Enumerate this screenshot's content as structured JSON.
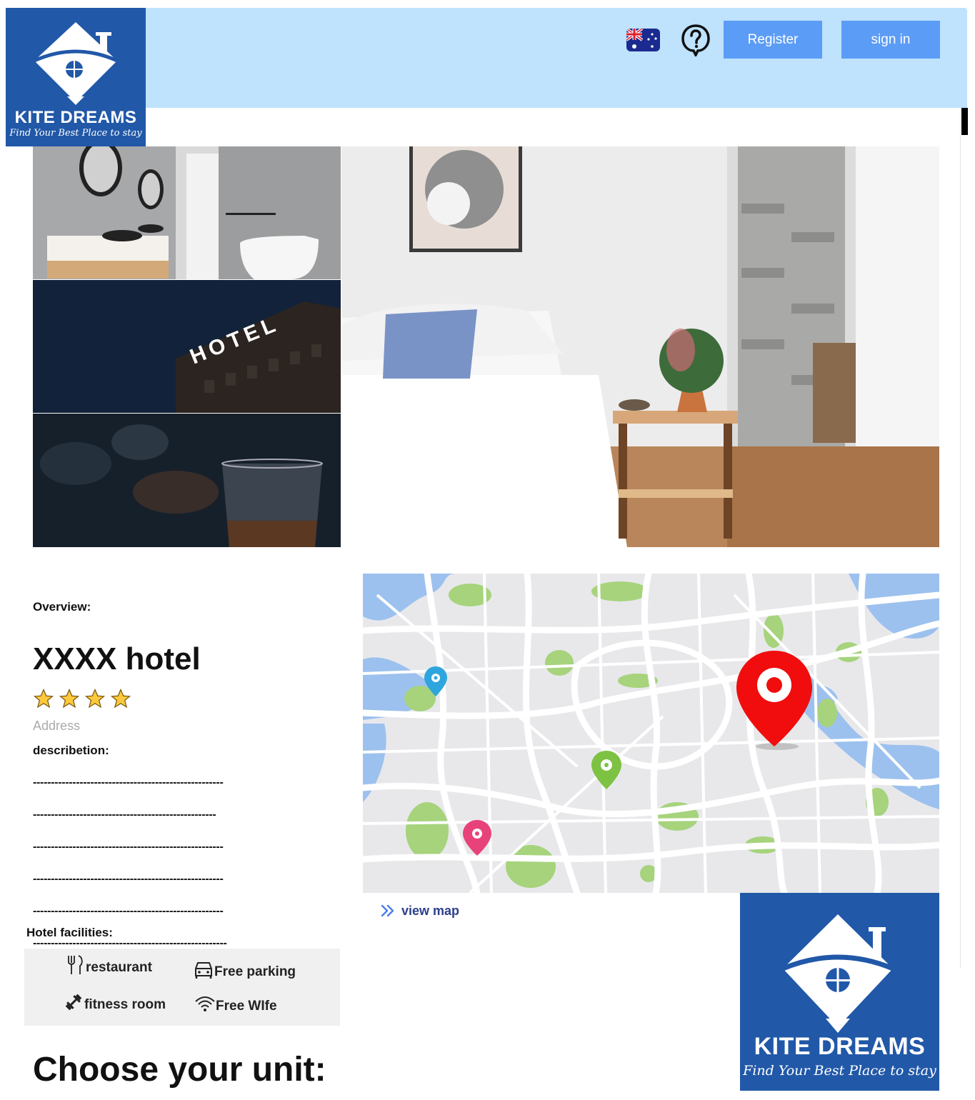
{
  "brand": {
    "name": "KITE DREAMS",
    "tagline": "Find Your Best Place to stay"
  },
  "header": {
    "language_icon": "australia-flag-icon",
    "help_icon": "question-chat-icon",
    "register_label": "Register",
    "signin_label": "sign in"
  },
  "gallery": {
    "photos": [
      "bathroom",
      "hotel-sign-night",
      "whisky-glass",
      "bedroom"
    ],
    "sign_text": "HOTEL"
  },
  "overview": {
    "label": "Overview:",
    "hotel_name": "XXXX hotel",
    "star_rating": 4,
    "address_placeholder": "Address",
    "description_label": "describetion:",
    "description_lines": [
      "-----------------------------------------------------",
      "---------------------------------------------------",
      "-----------------------------------------------------",
      "-----------------------------------------------------",
      "-----------------------------------------------------",
      "------------------------------------------------------",
      "------------------------------------------------------",
      "-----------------------------------------------------"
    ]
  },
  "map": {
    "view_map_label": "view map",
    "view_map_icon": "double-chevron-right-icon",
    "pin_colors": {
      "main": "#f10d0d",
      "blue": "#2ea6dd",
      "green": "#7dc242",
      "pink": "#e8427a"
    }
  },
  "facilities": {
    "label": "Hotel facilities:",
    "items": [
      {
        "icon": "fork-knife-icon",
        "label": "restaurant"
      },
      {
        "icon": "car-icon",
        "label": "Free parking"
      },
      {
        "icon": "dumbbell-icon",
        "label": "fitness room"
      },
      {
        "icon": "wifi-icon",
        "label": "Free WIfe"
      }
    ]
  },
  "units": {
    "heading": "Choose your unit:"
  },
  "colors": {
    "header_bg": "#bfe2fd",
    "button": "#5b9cf6",
    "logo_bg": "#2158a8",
    "link": "#2b3f8c"
  }
}
